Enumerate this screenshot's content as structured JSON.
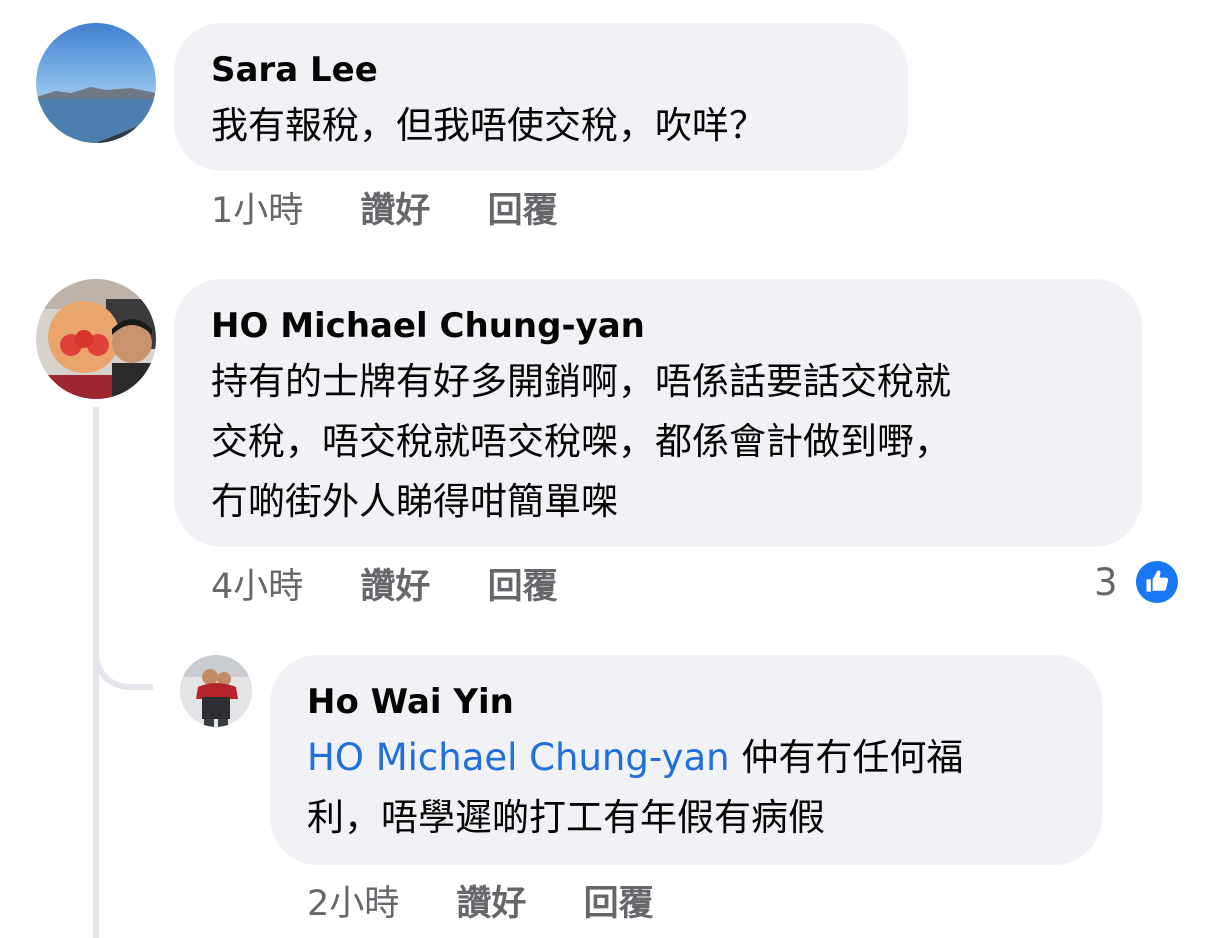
{
  "comments": [
    {
      "author": "Sara Lee",
      "lines": [
        "我有報稅，但我唔使交稅，吹咩？"
      ],
      "time": "1小時",
      "like_label": "讚好",
      "reply_label": "回覆"
    },
    {
      "author": "HO Michael Chung-yan",
      "lines": [
        "持有的士牌有好多開銷啊，唔係話要話交稅就",
        "交稅，唔交稅就唔交稅㗎，都係會計做到嘢，",
        "冇啲街外人睇得咁簡單㗎"
      ],
      "time": "4小時",
      "like_label": "讚好",
      "reply_label": "回覆",
      "reaction_count": "3",
      "reaction_icon": "thumbs-up-icon"
    }
  ],
  "reply": {
    "author": "Ho Wai Yin",
    "mention": "HO Michael Chung-yan",
    "line1_rest": " 仲有冇任何福",
    "line2": "利，唔學遲啲打工有年假有病假",
    "time": "2小時",
    "like_label": "讚好",
    "reply_label": "回覆"
  },
  "colors": {
    "bubble": "#f0f2f5",
    "meta_text": "#65676b",
    "mention": "#216fdb",
    "like_badge": "#1877f2"
  }
}
